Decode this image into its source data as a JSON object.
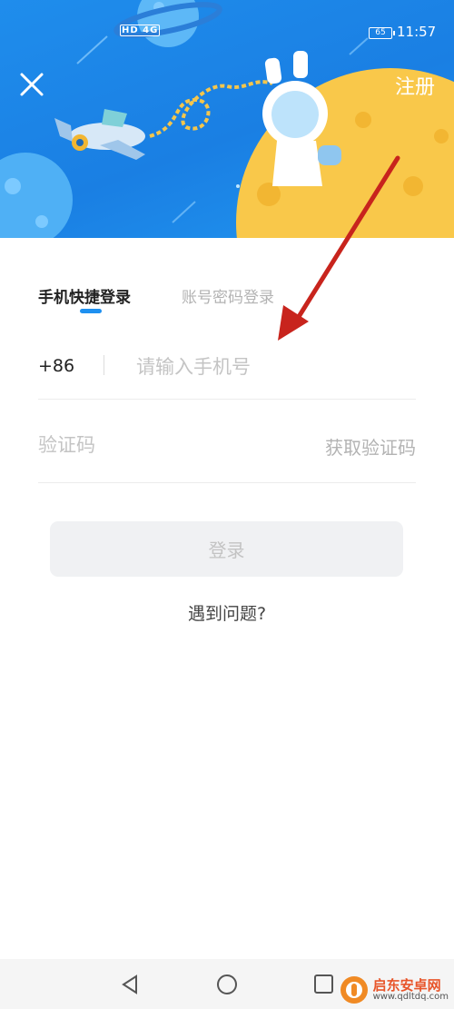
{
  "status_bar": {
    "network": "HD 4G",
    "battery": "65",
    "time": "11:57"
  },
  "header": {
    "register_label": "注册"
  },
  "tabs": [
    {
      "label": "手机快捷登录",
      "active": true
    },
    {
      "label": "账号密码登录",
      "active": false
    }
  ],
  "phone": {
    "country_code": "+86",
    "placeholder": "请输入手机号"
  },
  "verification": {
    "placeholder": "验证码",
    "get_code_label": "获取验证码"
  },
  "login_button": "登录",
  "help_link": "遇到问题?",
  "watermark": {
    "name": "启东安卓网",
    "url": "www.qdltdq.com"
  },
  "colors": {
    "banner_blue": "#1a7fe3",
    "accent": "#1e90f0",
    "planet_yellow": "#f9c84a",
    "arrow_red": "#c8241d"
  }
}
